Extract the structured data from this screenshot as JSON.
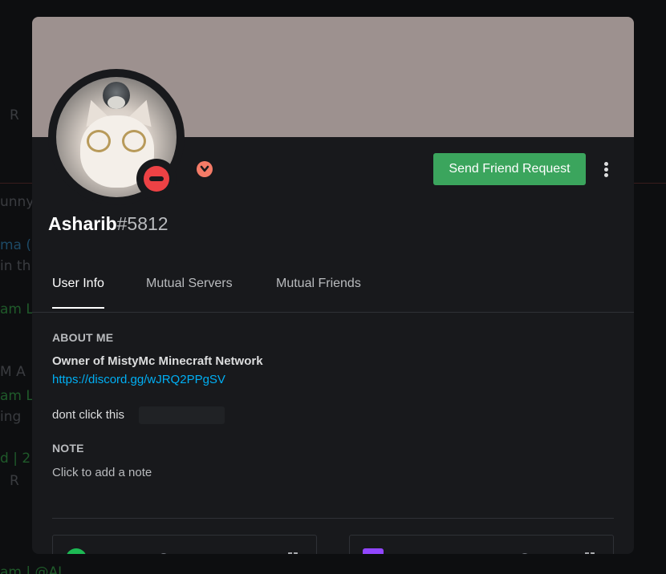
{
  "background_chat": {
    "lines": [
      "R",
      "unny",
      "ma (",
      "in th",
      "am L",
      "M A",
      "am L",
      "ing",
      "d | 2",
      "R",
      "am | @AL"
    ]
  },
  "profile": {
    "banner_color": "#9d918f",
    "avatar_icon": "cat-avatar",
    "status": "do-not-disturb",
    "status_color": "#ed4245",
    "badge_icon": "chevron-down-icon",
    "username": "Asharib",
    "discriminator": "#5812"
  },
  "actions": {
    "send_friend_request_label": "Send Friend Request",
    "more_icon": "vertical-ellipsis-icon",
    "accent_color": "#3ba55d"
  },
  "tabs": [
    {
      "label": "User Info",
      "active": true
    },
    {
      "label": "Mutual Servers",
      "active": false
    },
    {
      "label": "Mutual Friends",
      "active": false
    }
  ],
  "about_me": {
    "title": "ABOUT ME",
    "headline": "Owner of MistyMc Minecraft Network",
    "link": "https://discord.gg/wJRQ2PPgSV",
    "text": "dont click this"
  },
  "note": {
    "title": "NOTE",
    "placeholder": "Click to add a note"
  },
  "connections": [
    {
      "service": "spotify",
      "icon": "spotify-icon",
      "name": "",
      "color": "#1db954"
    },
    {
      "service": "twitch",
      "icon": "twitch-icon",
      "name": "",
      "color": "#9146ff"
    }
  ]
}
